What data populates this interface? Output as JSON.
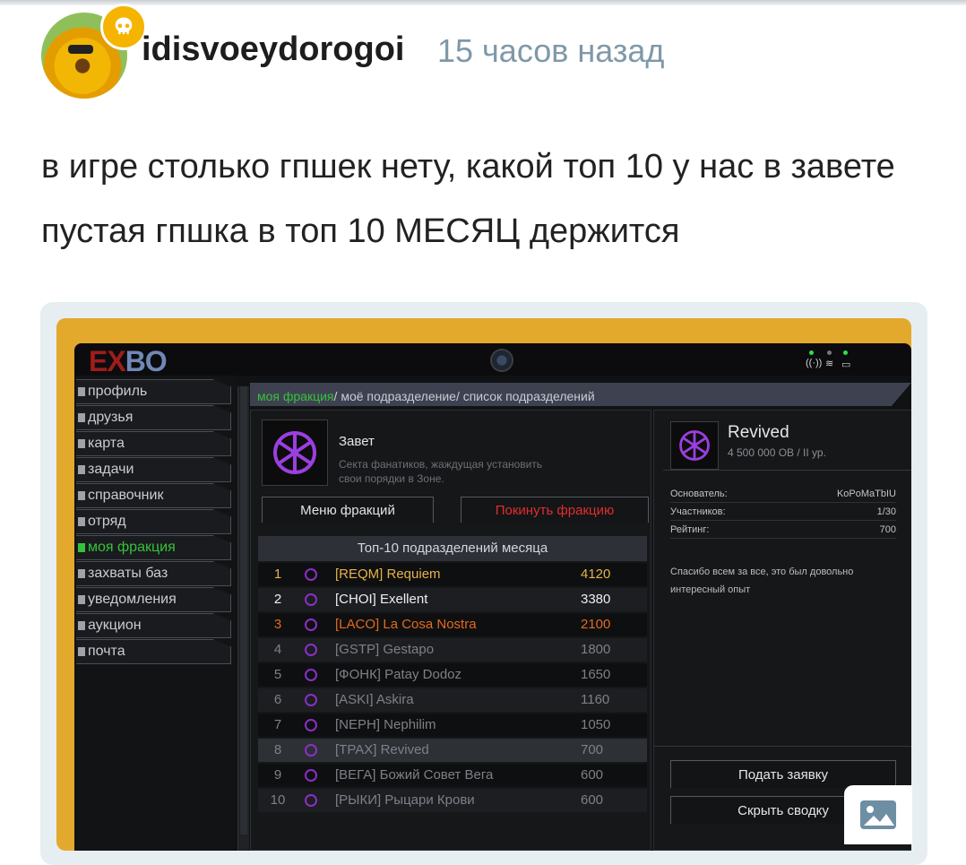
{
  "post": {
    "username": "idisvoeydorogoi",
    "timestamp": "15 часов назад",
    "text": "в игре столько гпшек нету, какой топ 10 у нас в завете пустая гпшка в топ 10 МЕСЯЦ держится"
  },
  "game": {
    "logo_main": "EX",
    "logo_accent": "BO",
    "sidebar": [
      {
        "label": "профиль",
        "active": false
      },
      {
        "label": "друзья",
        "active": false
      },
      {
        "label": "карта",
        "active": false
      },
      {
        "label": "задачи",
        "active": false
      },
      {
        "label": "справочник",
        "active": false
      },
      {
        "label": "отряд",
        "active": false
      },
      {
        "label": "моя фракция",
        "active": true
      },
      {
        "label": "захваты баз",
        "active": false
      },
      {
        "label": "уведомления",
        "active": false
      },
      {
        "label": "аукцион",
        "active": false
      },
      {
        "label": "почта",
        "active": false
      }
    ],
    "breadcrumb": {
      "active": "моя фракция",
      "sep": "/",
      "item2": "моё подразделение",
      "item3": "список подразделений"
    },
    "faction": {
      "name": "Завет",
      "description": "Секта фанатиков, жаждущая установить свои порядки в Зоне.",
      "menu_button": "Меню фракций",
      "leave_button": "Покинуть фракцию"
    },
    "top10": {
      "title": "Топ-10 подразделений месяца",
      "rows": [
        {
          "rank": "1",
          "name": "[REQM] Requiem",
          "score": "4120",
          "color": "gold"
        },
        {
          "rank": "2",
          "name": "[CHOI] Exellent",
          "score": "3380",
          "color": "white"
        },
        {
          "rank": "3",
          "name": "[LACO] La Cosa Nostra",
          "score": "2100",
          "color": "orange"
        },
        {
          "rank": "4",
          "name": "[GSTP] Gestapo",
          "score": "1800",
          "color": "grey"
        },
        {
          "rank": "5",
          "name": "[ФОНК] Patay Dodoz",
          "score": "1650",
          "color": "grey"
        },
        {
          "rank": "6",
          "name": "[ASKI] Askira",
          "score": "1160",
          "color": "grey"
        },
        {
          "rank": "7",
          "name": "[NEPH] Nephilim",
          "score": "1050",
          "color": "grey"
        },
        {
          "rank": "8",
          "name": "[TPAX] Revived",
          "score": "700",
          "color": "grey"
        },
        {
          "rank": "9",
          "name": "[ВЕГА] Божий Совет Вега",
          "score": "600",
          "color": "grey"
        },
        {
          "rank": "10",
          "name": "[РЫКИ] Рыцари Крови",
          "score": "600",
          "color": "grey"
        }
      ]
    },
    "unit": {
      "name": "Revived",
      "meta": "4 500 000 OB / II ур.",
      "founder_label": "Основатель:",
      "founder_value": "KoPoMaTbIU",
      "members_label": "Участников:",
      "members_value": "1/30",
      "rating_label": "Рейтинг:",
      "rating_value": "700",
      "message": "Спасибо всем за все, это был довольно интересный опыт",
      "apply_button": "Подать заявку",
      "hide_button": "Скрыть сводку"
    }
  },
  "icons": {
    "avatar_badge": "skull-icon",
    "gallery": "image-icon",
    "faction_emblem": "faction-emblem-icon"
  }
}
